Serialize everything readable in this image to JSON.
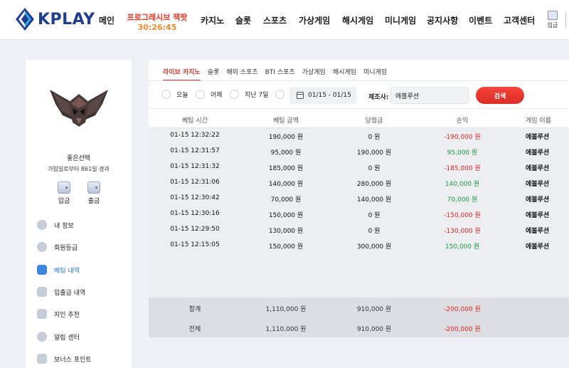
{
  "header": {
    "logo_text": "KPLAY",
    "nav": [
      "메인",
      "카지노",
      "슬롯",
      "스포츠",
      "가상게임",
      "해시게임",
      "미니게임",
      "공지사항",
      "이벤트",
      "고객센터"
    ],
    "promo_title": "프로그레시브 잭팟",
    "promo_timer": "30:26:45",
    "deposit_label": "입금"
  },
  "sidebar": {
    "username": "좋은선택",
    "joined": "가입일로부터 861일 경과",
    "deposit": "입금",
    "withdraw": "출금",
    "menu": [
      "내 정보",
      "회원등급",
      "베팅 내역",
      "입출금 내역",
      "지인 추천",
      "알림 센터",
      "보너스 포인트"
    ]
  },
  "tabs": [
    "라이브 카지노",
    "슬롯",
    "해외 스포츠",
    "BTI 스포츠",
    "가상게임",
    "해시게임",
    "미니게임"
  ],
  "filters": {
    "today": "오늘",
    "yesterday": "어제",
    "last7": "지난 7일",
    "date_range": "01/15 - 01/15",
    "provider_label": "제조사:",
    "provider_value": "에볼루션",
    "search": "검색"
  },
  "table": {
    "headers": [
      "베팅 시간",
      "베팅 금액",
      "당첨금",
      "손익",
      "게임 이름"
    ],
    "rows": [
      {
        "time": "01-15 12:32:22",
        "bet": "190,000 원",
        "win": "0 원",
        "pl": "-190,000 원",
        "game": "에볼루션"
      },
      {
        "time": "01-15 12:31:57",
        "bet": "95,000 원",
        "win": "190,000 원",
        "pl": "95,000 원",
        "game": "에볼루션"
      },
      {
        "time": "01-15 12:31:32",
        "bet": "185,000 원",
        "win": "0 원",
        "pl": "-185,000 원",
        "game": "에볼루션"
      },
      {
        "time": "01-15 12:31:06",
        "bet": "140,000 원",
        "win": "280,000 원",
        "pl": "140,000 원",
        "game": "에볼루션"
      },
      {
        "time": "01-15 12:30:42",
        "bet": "70,000 원",
        "win": "140,000 원",
        "pl": "70,000 원",
        "game": "에볼루션"
      },
      {
        "time": "01-15 12:30:16",
        "bet": "150,000 원",
        "win": "0 원",
        "pl": "-150,000 원",
        "game": "에볼루션"
      },
      {
        "time": "01-15 12:29:50",
        "bet": "130,000 원",
        "win": "0 원",
        "pl": "-130,000 원",
        "game": "에볼루션"
      },
      {
        "time": "01-15 12:15:05",
        "bet": "150,000 원",
        "win": "300,000 원",
        "pl": "150,000 원",
        "game": "에볼루션"
      }
    ],
    "totals": [
      {
        "label": "합계",
        "bet": "1,110,000 원",
        "win": "910,000 원",
        "pl": "-200,000 원"
      },
      {
        "label": "전체",
        "bet": "1,110,000 원",
        "win": "910,000 원",
        "pl": "-200,000 원"
      }
    ]
  },
  "colors": {
    "accent_red": "#e2231a",
    "profit_green": "#1a9a3a",
    "brand_blue": "#1d3d8f",
    "active_blue": "#2a78d6"
  }
}
